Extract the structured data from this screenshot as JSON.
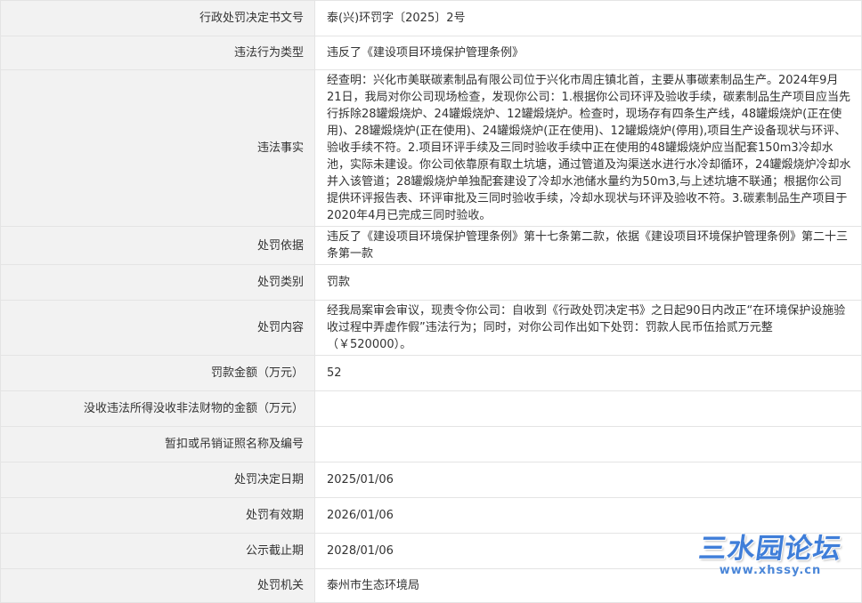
{
  "rows": [
    {
      "label": "行政处罚决定书文号",
      "value": "泰(兴)环罚字〔2025〕2号"
    },
    {
      "label": "违法行为类型",
      "value": "违反了《建设项目环境保护管理条例》"
    },
    {
      "label": "违法事实",
      "value": "经查明：兴化市美联碳素制品有限公司位于兴化市周庄镇北首，主要从事碳素制品生产。2024年9月21日，我局对你公司现场检查，发现你公司：1.根据你公司环评及验收手续，碳素制品生产项目应当先行拆除28罐煅烧炉、24罐煅烧炉、12罐煅烧炉。检查时，现场存有四条生产线，48罐煅烧炉(正在使用)、28罐煅烧炉(正在使用)、24罐煅烧炉(正在使用)、12罐煅烧炉(停用),项目生产设备现状与环评、验收手续不符。2.项目环评手续及三同时验收手续中正在使用的48罐煅烧炉应当配套150m3冷却水池，实际未建设。你公司依靠原有取土坑塘，通过管道及沟渠送水进行水冷却循环，24罐煅烧炉冷却水并入该管道；28罐煅烧炉单独配套建设了冷却水池储水量约为50m3,与上述坑塘不联通；根据你公司提供环评报告表、环评审批及三同时验收手续，冷却水现状与环评及验收不符。3.碳素制品生产项目于2020年4月已完成三同时验收。"
    },
    {
      "label": "处罚依据",
      "value": "违反了《建设项目环境保护管理条例》第十七条第二款，依据《建设项目环境保护管理条例》第二十三条第一款"
    },
    {
      "label": "处罚类别",
      "value": "罚款"
    },
    {
      "label": "处罚内容",
      "value": "经我局案审会审议，现责令你公司：自收到《行政处罚决定书》之日起90日内改正“在环境保护设施验收过程中弄虚作假”违法行为；同时，对你公司作出如下处罚：罚款人民币伍拾贰万元整（￥520000）。"
    },
    {
      "label": "罚款金额（万元）",
      "value": "52"
    },
    {
      "label": "没收违法所得没收非法财物的金额（万元）",
      "value": ""
    },
    {
      "label": "暂扣或吊销证照名称及编号",
      "value": ""
    },
    {
      "label": "处罚决定日期",
      "value": "2025/01/06"
    },
    {
      "label": "处罚有效期",
      "value": "2026/01/06"
    },
    {
      "label": "公示截止期",
      "value": "2028/01/06"
    },
    {
      "label": "处罚机关",
      "value": "泰州市生态环境局"
    }
  ],
  "watermark": {
    "logo": "三水园论坛",
    "url": "www.xhssy.cn"
  },
  "colors": {
    "label_bg": "#f2f2f2",
    "border": "#e4e4e4",
    "text": "#333333",
    "watermark": "#3f7ed9"
  }
}
